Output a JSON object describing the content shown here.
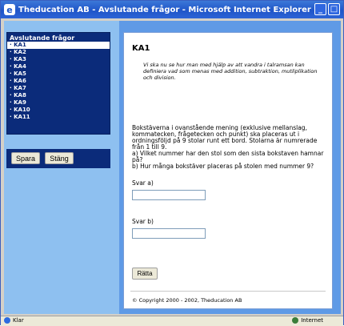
{
  "window": {
    "title": "Theducation AB - Avslutande frågor - Microsoft Internet Explorer",
    "ie_icon": "e",
    "minimize_label": "_",
    "maximize_label": "□"
  },
  "sidebar": {
    "title": "Avslutande frågor",
    "items": [
      {
        "label": "· KA1"
      },
      {
        "label": "· KA2"
      },
      {
        "label": "· KA3"
      },
      {
        "label": "· KA4"
      },
      {
        "label": "· KA5"
      },
      {
        "label": "· KA6"
      },
      {
        "label": "· KA7"
      },
      {
        "label": "· KA8"
      },
      {
        "label": "· KA9"
      },
      {
        "label": "· KA10"
      },
      {
        "label": "· KA11"
      }
    ],
    "selected_index": 0,
    "save_label": "Spara",
    "close_label": "Stäng"
  },
  "main": {
    "heading": "KA1",
    "intro": "Vi ska nu se hur man med hjälp av att vandra i talramsan kan definiera vad som menas med addition, subtraktion, mutliplikation och division.",
    "question": "Bokstäverna i ovanstående mening (exklusive mellanslag, kommatecken, frågetecken och punkt) ska placeras ut i ordningsföljd på 9 stolar runt ett bord. Stolarna är numrerade från 1 till 9.\na) Vilket nummer har den stol som den sista bokstaven hamnar på?\nb) Hur många bokstäver placeras på stolen med nummer 9?",
    "answer_a_label": "Svar a)",
    "answer_a_value": "",
    "answer_b_label": "Svar b)",
    "answer_b_value": "",
    "check_button_label": "Rätta",
    "copyright": "© Copyright 2000 - 2002, Theducation AB"
  },
  "statusbar": {
    "status_text": "Klar",
    "zone_text": "Internet"
  },
  "colors": {
    "nav_bg": "#0b2b7a",
    "panel_bg": "#8ec0f0",
    "frame_bg": "#5f9ae6",
    "titlebar": "#1f55c8"
  }
}
